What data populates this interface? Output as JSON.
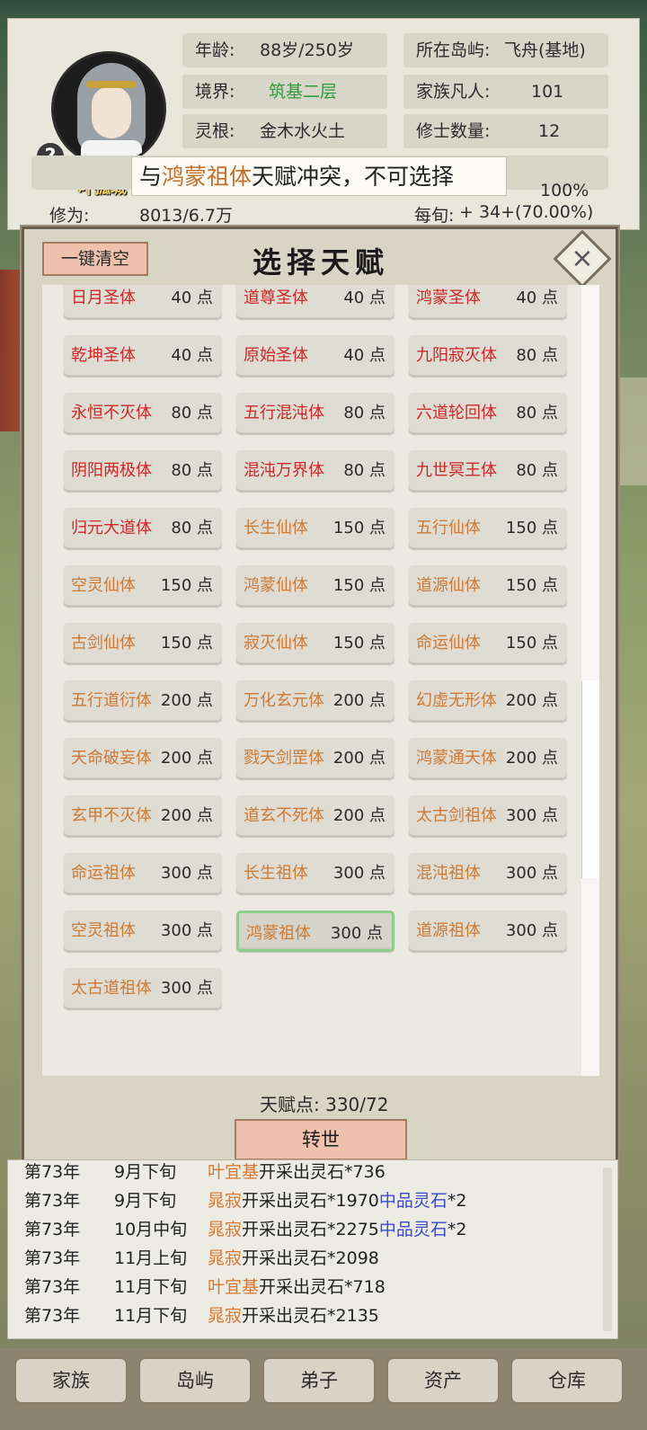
{
  "character": {
    "name": "叶孤城",
    "age_label": "年龄:",
    "age_value": "88岁/250岁",
    "island_label": "所在岛屿:",
    "island_value": "飞舟(基地)",
    "realm_label": "境界:",
    "realm_value": "筑基二层",
    "family_label": "家族凡人:",
    "family_value": "101",
    "root_label": "灵根:",
    "root_value": "金木水火土",
    "cultivators_label": "修士数量:",
    "cultivators_value": "12",
    "percent_value": "100%",
    "cultivation_label": "修为:",
    "cultivation_value": "8013/6.7万",
    "per_turn_label": "每旬:",
    "per_turn_value": "+ 34+(70.00%)"
  },
  "tooltip": {
    "prefix": "与",
    "highlight": "鸿蒙祖体",
    "suffix": "天赋冲突，不可选择"
  },
  "modal": {
    "clear_label": "一键清空",
    "title": "选择天赋",
    "close_icon": "close-icon",
    "talent_points_label": "天赋点:",
    "talent_points_value": "330/72",
    "rebirth_label": "转世"
  },
  "talents": [
    {
      "name": "日月圣体",
      "cost": "40 点",
      "color": "red"
    },
    {
      "name": "道尊圣体",
      "cost": "40 点",
      "color": "red"
    },
    {
      "name": "鸿蒙圣体",
      "cost": "40 点",
      "color": "red"
    },
    {
      "name": "乾坤圣体",
      "cost": "40 点",
      "color": "red"
    },
    {
      "name": "原始圣体",
      "cost": "40 点",
      "color": "red"
    },
    {
      "name": "九阳寂灭体",
      "cost": "80 点",
      "color": "red"
    },
    {
      "name": "永恒不灭体",
      "cost": "80 点",
      "color": "red"
    },
    {
      "name": "五行混沌体",
      "cost": "80 点",
      "color": "red"
    },
    {
      "name": "六道轮回体",
      "cost": "80 点",
      "color": "red"
    },
    {
      "name": "阴阳两极体",
      "cost": "80 点",
      "color": "red"
    },
    {
      "name": "混沌万界体",
      "cost": "80 点",
      "color": "red"
    },
    {
      "name": "九世冥王体",
      "cost": "80 点",
      "color": "red"
    },
    {
      "name": "归元大道体",
      "cost": "80 点",
      "color": "red"
    },
    {
      "name": "长生仙体",
      "cost": "150 点",
      "color": "orange"
    },
    {
      "name": "五行仙体",
      "cost": "150 点",
      "color": "orange"
    },
    {
      "name": "空灵仙体",
      "cost": "150 点",
      "color": "orange"
    },
    {
      "name": "鸿蒙仙体",
      "cost": "150 点",
      "color": "orange"
    },
    {
      "name": "道源仙体",
      "cost": "150 点",
      "color": "orange"
    },
    {
      "name": "古剑仙体",
      "cost": "150 点",
      "color": "orange"
    },
    {
      "name": "寂灭仙体",
      "cost": "150 点",
      "color": "orange"
    },
    {
      "name": "命运仙体",
      "cost": "150 点",
      "color": "orange"
    },
    {
      "name": "五行道衍体",
      "cost": "200 点",
      "color": "orange"
    },
    {
      "name": "万化玄元体",
      "cost": "200 点",
      "color": "orange"
    },
    {
      "name": "幻虚无形体",
      "cost": "200 点",
      "color": "orange"
    },
    {
      "name": "天命破妄体",
      "cost": "200 点",
      "color": "orange"
    },
    {
      "name": "戮天剑罡体",
      "cost": "200 点",
      "color": "orange"
    },
    {
      "name": "鸿蒙通天体",
      "cost": "200 点",
      "color": "orange"
    },
    {
      "name": "玄甲不灭体",
      "cost": "200 点",
      "color": "orange"
    },
    {
      "name": "道玄不死体",
      "cost": "200 点",
      "color": "orange"
    },
    {
      "name": "太古剑祖体",
      "cost": "300 点",
      "color": "orange"
    },
    {
      "name": "命运祖体",
      "cost": "300 点",
      "color": "orange"
    },
    {
      "name": "长生祖体",
      "cost": "300 点",
      "color": "orange"
    },
    {
      "name": "混沌祖体",
      "cost": "300 点",
      "color": "orange"
    },
    {
      "name": "空灵祖体",
      "cost": "300 点",
      "color": "orange"
    },
    {
      "name": "鸿蒙祖体",
      "cost": "300 点",
      "color": "orange",
      "selected": true
    },
    {
      "name": "道源祖体",
      "cost": "300 点",
      "color": "orange"
    },
    {
      "name": "太古道祖体",
      "cost": "300 点",
      "color": "orange"
    }
  ],
  "log": [
    {
      "year": "第73年",
      "month": "9月下旬",
      "who": "叶宜基",
      "text": "开采出灵石*736",
      "extra": ""
    },
    {
      "year": "第73年",
      "month": "9月下旬",
      "who": "晁寂",
      "text": "开采出灵石*1970",
      "extra": "中品灵石",
      "extra_count": "*2"
    },
    {
      "year": "第73年",
      "month": "10月中旬",
      "who": "晁寂",
      "text": "开采出灵石*2275",
      "extra": "中品灵石",
      "extra_count": "*2"
    },
    {
      "year": "第73年",
      "month": "11月上旬",
      "who": "晁寂",
      "text": "开采出灵石*2098",
      "extra": ""
    },
    {
      "year": "第73年",
      "month": "11月下旬",
      "who": "叶宜基",
      "text": "开采出灵石*718",
      "extra": ""
    },
    {
      "year": "第73年",
      "month": "11月下旬",
      "who": "晁寂",
      "text": "开采出灵石*2135",
      "extra": ""
    }
  ],
  "nav": [
    "家族",
    "岛屿",
    "弟子",
    "资产",
    "仓库"
  ]
}
